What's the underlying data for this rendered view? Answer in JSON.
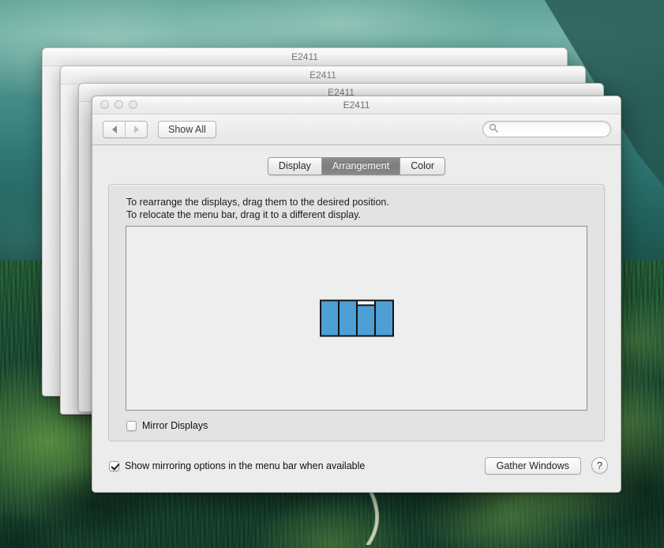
{
  "desktop": {
    "wallpaper_description": "aerial photo of forested alpine valley with winding road",
    "colors": {
      "sky_teal": "#4e938c",
      "forest_dark": "#1b4a33",
      "meadow_green": "#84ba56"
    }
  },
  "background_windows": [
    {
      "title": "E2411"
    },
    {
      "title": "E2411"
    },
    {
      "title": "E2411"
    }
  ],
  "window": {
    "title": "E2411",
    "traffic_lights": [
      "close-button",
      "minimize-button",
      "zoom-button"
    ],
    "toolbar": {
      "back_label": "◀",
      "forward_label": "▶",
      "show_all_label": "Show All",
      "search_placeholder": "",
      "search_value": ""
    },
    "tabs": [
      {
        "label": "Display",
        "selected": false
      },
      {
        "label": "Arrangement",
        "selected": true
      },
      {
        "label": "Color",
        "selected": false
      }
    ],
    "arrangement": {
      "hint_line_1": "To rearrange the displays, drag them to the desired position.",
      "hint_line_2": "To relocate the menu bar, drag it to a different display.",
      "displays": [
        {
          "index": 1,
          "has_menu_bar": false,
          "color": "#4d9fd6"
        },
        {
          "index": 2,
          "has_menu_bar": false,
          "color": "#4d9fd6"
        },
        {
          "index": 3,
          "has_menu_bar": true,
          "color": "#4d9fd6"
        },
        {
          "index": 4,
          "has_menu_bar": false,
          "color": "#4d9fd6"
        }
      ],
      "mirror_displays": {
        "label": "Mirror Displays",
        "checked": false
      }
    },
    "footer": {
      "show_mirroring_options": {
        "label": "Show mirroring options in the menu bar when available",
        "checked": true
      },
      "gather_windows_label": "Gather Windows",
      "help_label": "?"
    }
  }
}
